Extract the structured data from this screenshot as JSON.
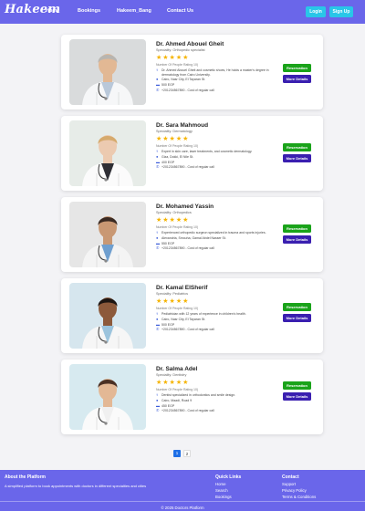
{
  "header": {
    "logo": "Hakeem",
    "nav": [
      "Home",
      "Bookings",
      "Hakeem_Bang",
      "Contact Us"
    ],
    "login": "Login",
    "signup": "Sign Up",
    "colors": {
      "bar": "#6a66ea",
      "auth": "#29c6e8"
    }
  },
  "doctors": [
    {
      "name": "Dr. Ahmed Abouel Gheit",
      "specialty": "Speciality: Orthopedic specialist",
      "stars": "★★★★★",
      "rating_label": "Number Of People Rating 10)",
      "about": "Dr. Ahmed Abouel Gheit and cosmetic shoes, He holds a master's degree in dermatology from Cairo University.",
      "address": "Cairo, Nasr City, El Tayaran St.",
      "fee": "500 EGP",
      "phone": "+201234567890 - Cost of regular call",
      "reserve": "Reservation",
      "more": "More Details",
      "palette": {
        "bg": "#d9dbdc",
        "coat": "#f6f7f8",
        "shirt": "#b9c8d9",
        "skin": "#e2b894",
        "hair": "#b8b5b0"
      }
    },
    {
      "name": "Dr. Sara Mahmoud",
      "specialty": "Speciality: Dermatology",
      "stars": "★★★★★",
      "rating_label": "Number Of People Rating 10)",
      "about": "Expert in skin care, laser treatments, and cosmetic dermatology.",
      "address": "Giza, Dokki, El Nile St.",
      "fee": "400 EGP",
      "phone": "+201234567890 - Cost of regular call",
      "reserve": "Reservation",
      "more": "More Details",
      "palette": {
        "bg": "#e7ece8",
        "coat": "#fbfbfb",
        "shirt": "#2f2f35",
        "skin": "#eccab0",
        "hair": "#d6aa6d"
      }
    },
    {
      "name": "Dr. Mohamed Yassin",
      "specialty": "Speciality: Orthopedics",
      "stars": "★★★★★",
      "rating_label": "Number Of People Rating 10)",
      "about": "Experienced orthopedic surgeon specialized in trauma and sports injuries.",
      "address": "Alexandria, Smouha, Gamal Abdel Nasser St.",
      "fee": "550 EGP",
      "phone": "+201234567890 - Cost of regular call",
      "reserve": "Reservation",
      "more": "More Details",
      "palette": {
        "bg": "#e6e6e6",
        "coat": "#f4f4f4",
        "shirt": "#6f9fcf",
        "skin": "#c99873",
        "hair": "#3a2a22"
      }
    },
    {
      "name": "Dr. Kamal ElSherif",
      "specialty": "Speciality: Pediatrics",
      "stars": "★★★★★",
      "rating_label": "Number Of People Rating 10)",
      "about": "Pediatrician with 12 years of experience in children's health.",
      "address": "Cairo, Nasr City, El Tayaran St.",
      "fee": "500 EGP",
      "phone": "+201234567890 - Cost of regular call",
      "reserve": "Reservation",
      "more": "More Details",
      "palette": {
        "bg": "#d6e6ee",
        "coat": "#f6f6f6",
        "shirt": "#9cc4dd",
        "skin": "#8d5a3b",
        "hair": "#1e1612"
      }
    },
    {
      "name": "Dr. Salma Adel",
      "specialty": "Speciality: Dentistry",
      "stars": "★★★★★",
      "rating_label": "Number Of People Rating 10)",
      "about": "Dentist specialized in orthodontics and smile design.",
      "address": "Cairo, Maadi, Road 9",
      "fee": "450 EGP",
      "phone": "+201234567890 - Cost of regular call",
      "reserve": "Reservation",
      "more": "More Details",
      "palette": {
        "bg": "#d7eaf0",
        "coat": "#fafafa",
        "shirt": "#f0f0f0",
        "skin": "#e3b895",
        "hair": "#4a3024"
      }
    }
  ],
  "pagination": [
    "1",
    "2"
  ],
  "footer": {
    "about_title": "About the Platform",
    "about_text": "A simplified platform to book appointments with doctors in different specialties and cities",
    "quick_title": "Quick Links",
    "quick_links": [
      "Home",
      "Search",
      "Bookings"
    ],
    "contact_title": "Contact",
    "contact_links": [
      "Support",
      "Privacy Policy",
      "Terms & Conditions"
    ],
    "copyright": "© 2025 Doctors Platform"
  }
}
